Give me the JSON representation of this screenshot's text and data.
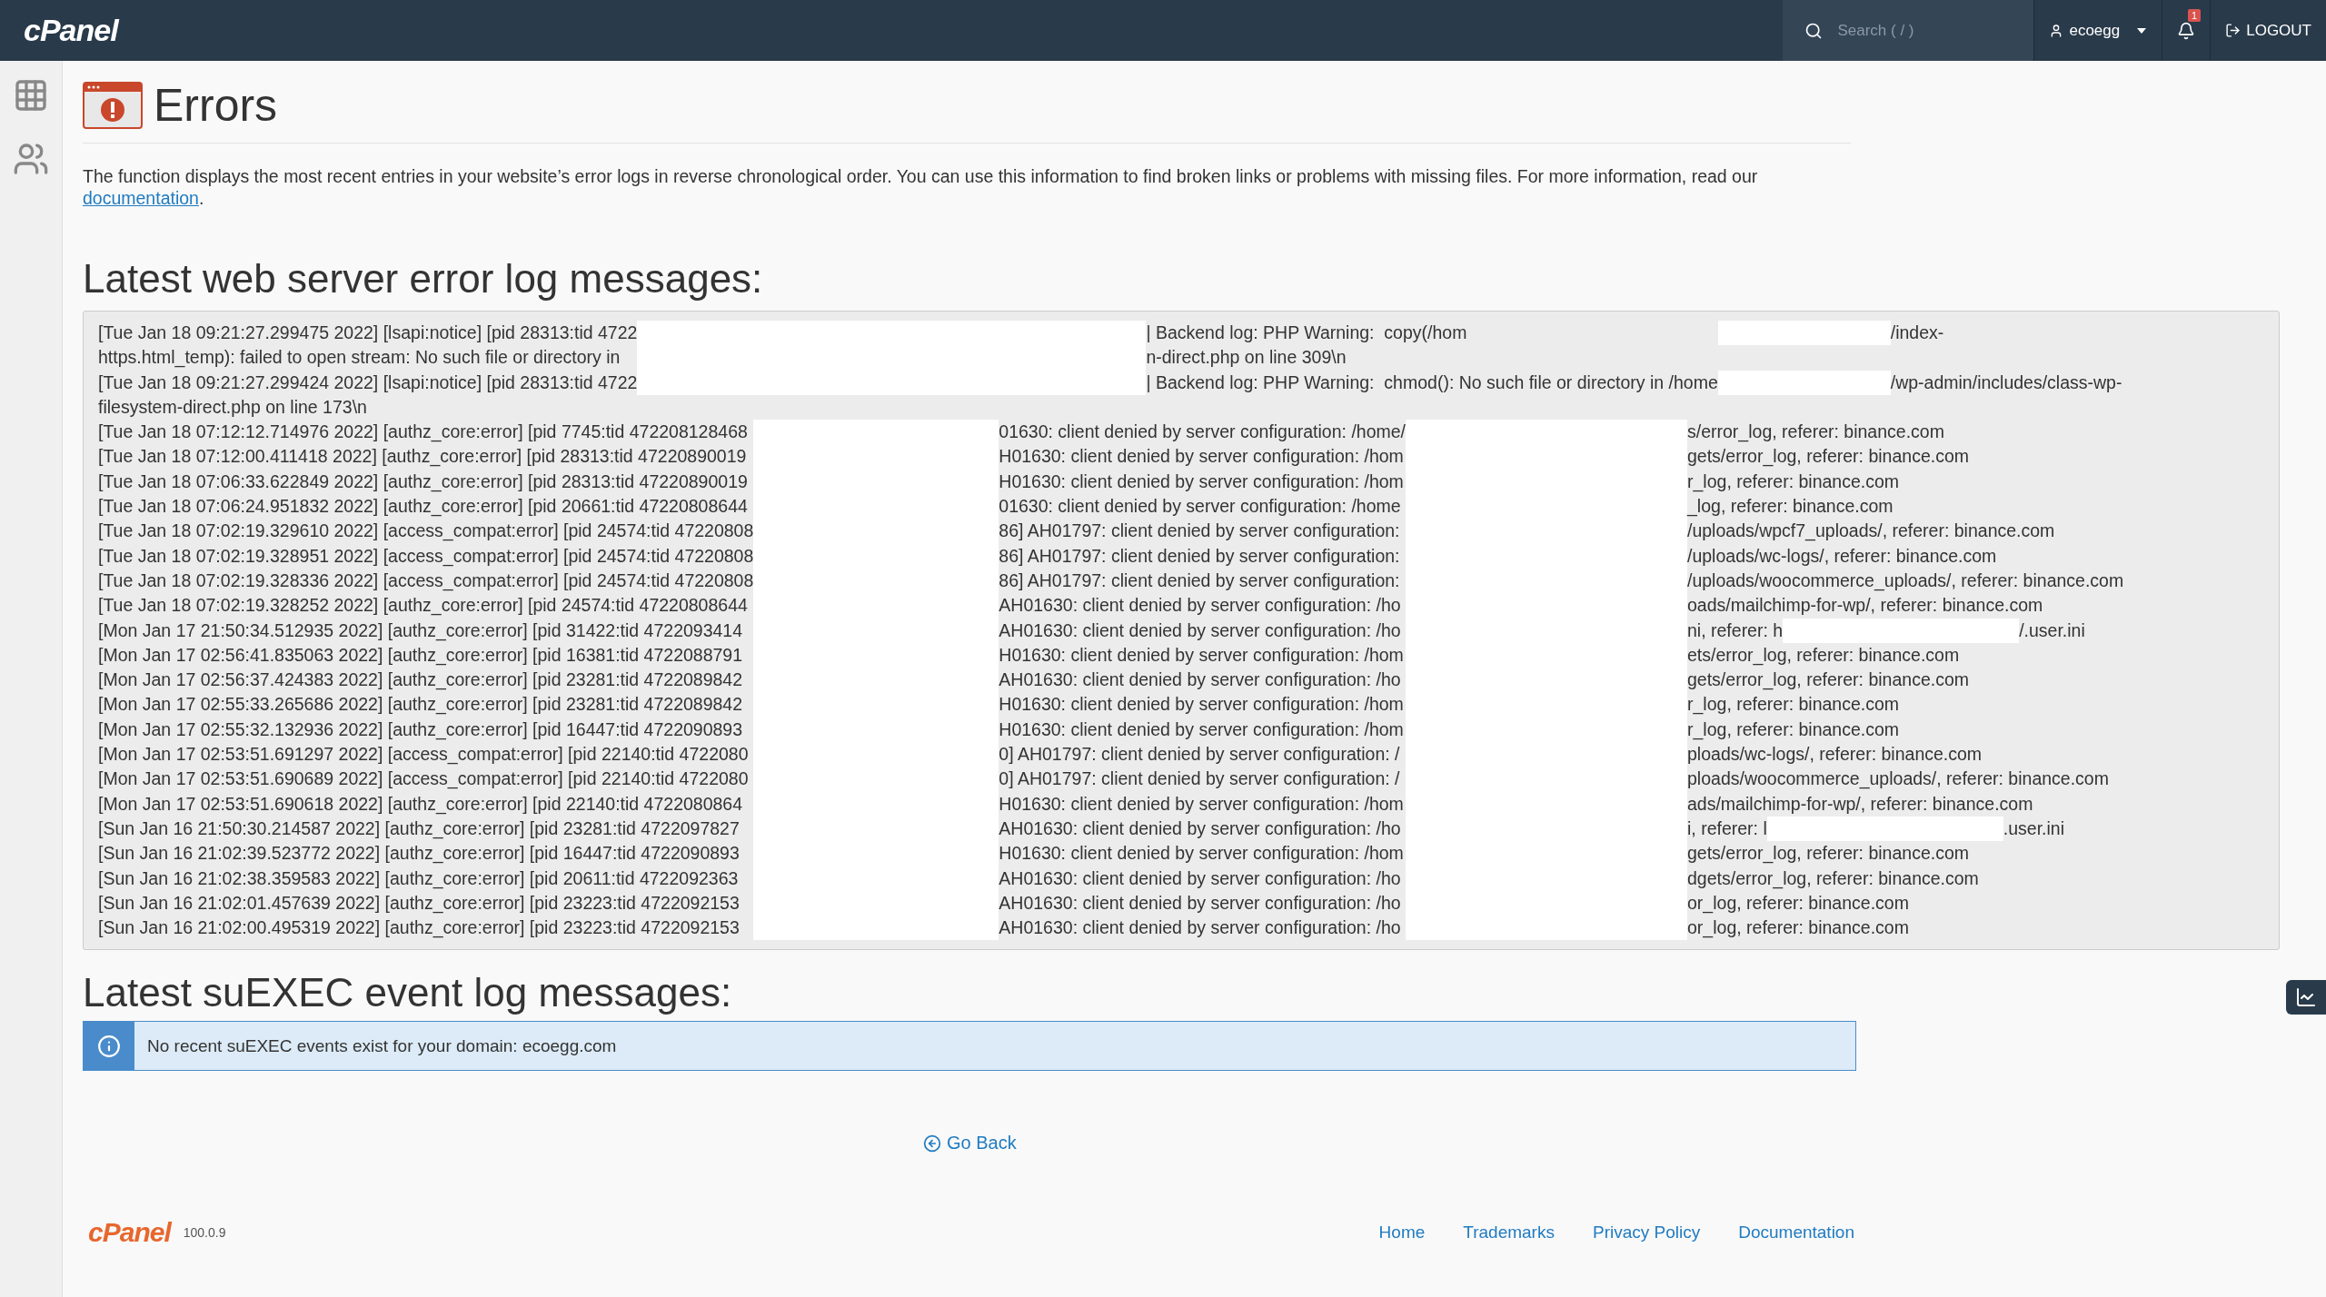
{
  "navbar": {
    "logo": "cPanel",
    "search": {
      "placeholder": "Search ( / )"
    },
    "user": {
      "name": "ecoegg"
    },
    "notifications": {
      "count": "1"
    },
    "logout": "LOGOUT"
  },
  "sidebar": {
    "items": [
      {
        "kind": "apps",
        "selected": false
      },
      {
        "kind": "users",
        "selected": false
      }
    ]
  },
  "page": {
    "title": "Errors",
    "description": "The function displays the most recent entries in your website’s error logs in reverse chronological order. You can use this information to find broken links or problems with missing files. For more information, read our",
    "description_link": "documentation",
    "description_end": "."
  },
  "error_log": {
    "heading": "Latest web server error log messages:",
    "top_entries": [
      {
        "parts": [
          "[Tue Jan 18 09:21:27.299475 2022] [lsapi:notice] [pid 28313:tid 4722",
          "| Backend log: PHP Warning:  copy(/hom",
          "/index-"
        ]
      },
      {
        "parts": [
          "https.html_temp): failed to open stream: No such file or directory in",
          "n-direct.php on line 309\\n"
        ]
      },
      {
        "parts": [
          "[Tue Jan 18 09:21:27.299424 2022] [lsapi:notice] [pid 28313:tid 4722",
          "| Backend log: PHP Warning:  chmod(): No such file or directory in /home",
          "/wp-admin/includes/class-wp-"
        ]
      },
      {
        "parts": [
          "filesystem-direct.php on line 173\\n"
        ]
      }
    ],
    "entries": [
      {
        "parts": [
          "[Tue Jan 18 07:12:12.714976 2022] [authz_core:error] [pid 7745:tid 472208128468",
          "01630: client denied by server configuration: /home/",
          "s/error_log, referer: binance.com"
        ]
      },
      {
        "parts": [
          "[Tue Jan 18 07:12:00.411418 2022] [authz_core:error] [pid 28313:tid 47220890019",
          "H01630: client denied by server configuration: /hom",
          "gets/error_log, referer: binance.com"
        ]
      },
      {
        "parts": [
          "[Tue Jan 18 07:06:33.622849 2022] [authz_core:error] [pid 28313:tid 47220890019",
          "H01630: client denied by server configuration: /hom",
          "r_log, referer: binance.com"
        ]
      },
      {
        "parts": [
          "[Tue Jan 18 07:06:24.951832 2022] [authz_core:error] [pid 20661:tid 47220808644",
          "01630: client denied by server configuration: /home",
          "_log, referer: binance.com"
        ]
      },
      {
        "parts": [
          "[Tue Jan 18 07:02:19.329610 2022] [access_compat:error] [pid 24574:tid 47220808",
          "86] AH01797: client denied by server configuration:",
          "/uploads/wpcf7_uploads/, referer: binance.com"
        ]
      },
      {
        "parts": [
          "[Tue Jan 18 07:02:19.328951 2022] [access_compat:error] [pid 24574:tid 47220808",
          "86] AH01797: client denied by server configuration:",
          "/uploads/wc-logs/, referer: binance.com"
        ]
      },
      {
        "parts": [
          "[Tue Jan 18 07:02:19.328336 2022] [access_compat:error] [pid 24574:tid 47220808",
          "86] AH01797: client denied by server configuration:",
          "/uploads/woocommerce_uploads/, referer: binance.com"
        ]
      },
      {
        "parts": [
          "[Tue Jan 18 07:02:19.328252 2022] [authz_core:error] [pid 24574:tid 47220808644",
          "AH01630: client denied by server configuration: /ho",
          "oads/mailchimp-for-wp/, referer: binance.com"
        ]
      },
      {
        "parts": [
          "[Mon Jan 17 21:50:34.512935 2022] [authz_core:error] [pid 31422:tid 4722093414",
          "AH01630: client denied by server configuration: /ho",
          "ni, referer: h",
          "/.user.ini"
        ]
      },
      {
        "parts": [
          "[Mon Jan 17 02:56:41.835063 2022] [authz_core:error] [pid 16381:tid 4722088791",
          "H01630: client denied by server configuration: /hom",
          "ets/error_log, referer: binance.com"
        ]
      },
      {
        "parts": [
          "[Mon Jan 17 02:56:37.424383 2022] [authz_core:error] [pid 23281:tid 4722089842",
          "AH01630: client denied by server configuration: /ho",
          "gets/error_log, referer: binance.com"
        ]
      },
      {
        "parts": [
          "[Mon Jan 17 02:55:33.265686 2022] [authz_core:error] [pid 23281:tid 4722089842",
          "H01630: client denied by server configuration: /hom",
          "r_log, referer: binance.com"
        ]
      },
      {
        "parts": [
          "[Mon Jan 17 02:55:32.132936 2022] [authz_core:error] [pid 16447:tid 4722090893",
          "H01630: client denied by server configuration: /hom",
          "r_log, referer: binance.com"
        ]
      },
      {
        "parts": [
          "[Mon Jan 17 02:53:51.691297 2022] [access_compat:error] [pid 22140:tid 4722080",
          "0] AH01797: client denied by server configuration: /",
          "ploads/wc-logs/, referer: binance.com"
        ]
      },
      {
        "parts": [
          "[Mon Jan 17 02:53:51.690689 2022] [access_compat:error] [pid 22140:tid 4722080",
          "0] AH01797: client denied by server configuration: /",
          "ploads/woocommerce_uploads/, referer: binance.com"
        ]
      },
      {
        "parts": [
          "[Mon Jan 17 02:53:51.690618 2022] [authz_core:error] [pid 22140:tid 4722080864",
          "H01630: client denied by server configuration: /hom",
          "ads/mailchimp-for-wp/, referer: binance.com"
        ]
      },
      {
        "parts": [
          "[Sun Jan 16 21:50:30.214587 2022] [authz_core:error] [pid 23281:tid 4722097827",
          "AH01630: client denied by server configuration: /ho",
          "i, referer: l",
          ".user.ini"
        ]
      },
      {
        "parts": [
          "[Sun Jan 16 21:02:39.523772 2022] [authz_core:error] [pid 16447:tid 4722090893",
          "H01630: client denied by server configuration: /hom",
          "gets/error_log, referer: binance.com"
        ]
      },
      {
        "parts": [
          "[Sun Jan 16 21:02:38.359583 2022] [authz_core:error] [pid 20611:tid 4722092363",
          "AH01630: client denied by server configuration: /ho",
          "dgets/error_log, referer: binance.com"
        ]
      },
      {
        "parts": [
          "[Sun Jan 16 21:02:01.457639 2022] [authz_core:error] [pid 23223:tid 4722092153",
          "AH01630: client denied by server configuration: /ho",
          "or_log, referer: binance.com"
        ]
      },
      {
        "parts": [
          "[Sun Jan 16 21:02:00.495319 2022] [authz_core:error] [pid 23223:tid 4722092153",
          "AH01630: client denied by server configuration: /ho",
          "or_log, referer: binance.com"
        ]
      }
    ]
  },
  "suexec_log": {
    "heading": "Latest suEXEC event log messages:",
    "alert": {
      "kind": "info",
      "message": "No recent suEXEC events exist for your domain: ecoegg.com"
    }
  },
  "go_back": "Go Back",
  "footer": {
    "logo": "cPanel",
    "version": "100.0.9",
    "links": [
      "Home",
      "Trademarks",
      "Privacy Policy",
      "Documentation"
    ]
  }
}
